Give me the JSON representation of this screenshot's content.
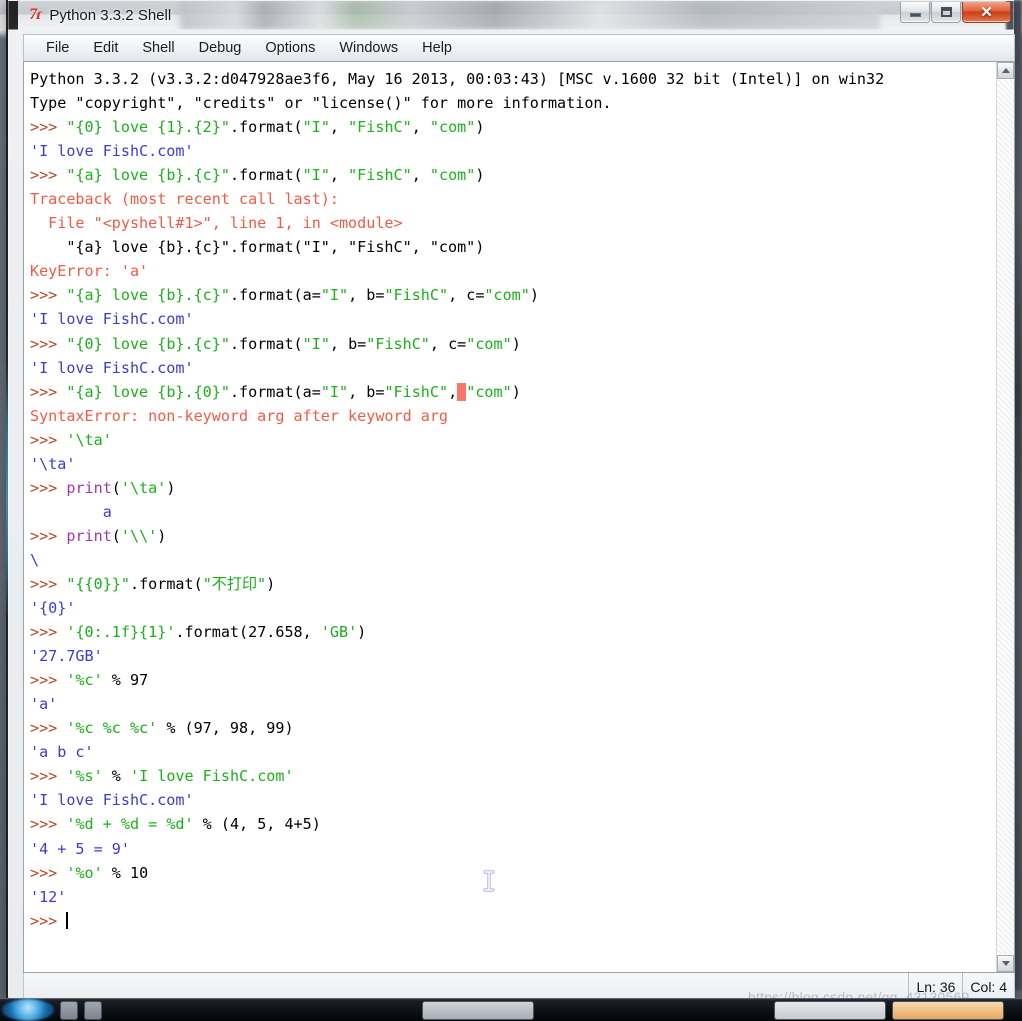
{
  "window": {
    "title": "Python 3.3.2 Shell",
    "icon": "python-logo-icon",
    "controls": {
      "minimize_label": "—",
      "maximize_label": "□",
      "close_label": "✕"
    }
  },
  "menu": {
    "items": [
      "File",
      "Edit",
      "Shell",
      "Debug",
      "Options",
      "Windows",
      "Help"
    ]
  },
  "colors": {
    "prompt": "#b5462b",
    "string": "#19b219",
    "output": "#3b3bd2",
    "error": "#f25a48",
    "builtin": "#a535a5",
    "plain": "#000000",
    "error_highlight": "#f7776a",
    "close_button": "#c73f17"
  },
  "shell": {
    "lines": [
      [
        {
          "t": "Python 3.3.2 (v3.3.2:d047928ae3f6, May 16 2013, 00:03:43) [MSC v.1600 32 bit (Intel)] on win32",
          "c": "plain"
        }
      ],
      [
        {
          "t": "Type \"copyright\", \"credits\" or \"license()\" for more information.",
          "c": "plain"
        }
      ],
      [
        {
          "t": ">>> ",
          "c": "prompt"
        },
        {
          "t": "\"{0} love {1}.{2}\"",
          "c": "str"
        },
        {
          "t": ".format(",
          "c": "plain"
        },
        {
          "t": "\"I\"",
          "c": "str"
        },
        {
          "t": ", ",
          "c": "plain"
        },
        {
          "t": "\"FishC\"",
          "c": "str"
        },
        {
          "t": ", ",
          "c": "plain"
        },
        {
          "t": "\"com\"",
          "c": "str"
        },
        {
          "t": ")",
          "c": "plain"
        }
      ],
      [
        {
          "t": "'I love FishC.com'",
          "c": "out"
        }
      ],
      [
        {
          "t": ">>> ",
          "c": "prompt"
        },
        {
          "t": "\"{a} love {b}.{c}\"",
          "c": "str"
        },
        {
          "t": ".format(",
          "c": "plain"
        },
        {
          "t": "\"I\"",
          "c": "str"
        },
        {
          "t": ", ",
          "c": "plain"
        },
        {
          "t": "\"FishC\"",
          "c": "str"
        },
        {
          "t": ", ",
          "c": "plain"
        },
        {
          "t": "\"com\"",
          "c": "str"
        },
        {
          "t": ")",
          "c": "plain"
        }
      ],
      [
        {
          "t": "Traceback (most recent call last):",
          "c": "err"
        }
      ],
      [
        {
          "t": "  File \"<pyshell#1>\", line 1, in <module>",
          "c": "err"
        }
      ],
      [
        {
          "t": "    \"{a} love {b}.{c}\".format(\"I\", \"FishC\", \"com\")",
          "c": "plain"
        }
      ],
      [
        {
          "t": "KeyError: 'a'",
          "c": "err"
        }
      ],
      [
        {
          "t": ">>> ",
          "c": "prompt"
        },
        {
          "t": "\"{a} love {b}.{c}\"",
          "c": "str"
        },
        {
          "t": ".format(a=",
          "c": "plain"
        },
        {
          "t": "\"I\"",
          "c": "str"
        },
        {
          "t": ", b=",
          "c": "plain"
        },
        {
          "t": "\"FishC\"",
          "c": "str"
        },
        {
          "t": ", c=",
          "c": "plain"
        },
        {
          "t": "\"com\"",
          "c": "str"
        },
        {
          "t": ")",
          "c": "plain"
        }
      ],
      [
        {
          "t": "'I love FishC.com'",
          "c": "out"
        }
      ],
      [
        {
          "t": ">>> ",
          "c": "prompt"
        },
        {
          "t": "\"{0} love {b}.{c}\"",
          "c": "str"
        },
        {
          "t": ".format(",
          "c": "plain"
        },
        {
          "t": "\"I\"",
          "c": "str"
        },
        {
          "t": ", b=",
          "c": "plain"
        },
        {
          "t": "\"FishC\"",
          "c": "str"
        },
        {
          "t": ", c=",
          "c": "plain"
        },
        {
          "t": "\"com\"",
          "c": "str"
        },
        {
          "t": ")",
          "c": "plain"
        }
      ],
      [
        {
          "t": "'I love FishC.com'",
          "c": "out"
        }
      ],
      [
        {
          "t": ">>> ",
          "c": "prompt"
        },
        {
          "t": "\"{a} love {b}.{0}\"",
          "c": "str"
        },
        {
          "t": ".format(a=",
          "c": "plain"
        },
        {
          "t": "\"I\"",
          "c": "str"
        },
        {
          "t": ", b=",
          "c": "plain"
        },
        {
          "t": "\"FishC\"",
          "c": "str"
        },
        {
          "t": ",",
          "c": "plain"
        },
        {
          "t": "X",
          "c": "errhl"
        },
        {
          "t": "\"com\"",
          "c": "str"
        },
        {
          "t": ")",
          "c": "plain"
        }
      ],
      [
        {
          "t": "SyntaxError: non-keyword arg after keyword arg",
          "c": "err"
        }
      ],
      [
        {
          "t": ">>> ",
          "c": "prompt"
        },
        {
          "t": "'\\ta'",
          "c": "str"
        }
      ],
      [
        {
          "t": "'\\ta'",
          "c": "out"
        }
      ],
      [
        {
          "t": ">>> ",
          "c": "prompt"
        },
        {
          "t": "print",
          "c": "builtin"
        },
        {
          "t": "(",
          "c": "plain"
        },
        {
          "t": "'\\ta'",
          "c": "str"
        },
        {
          "t": ")",
          "c": "plain"
        }
      ],
      [
        {
          "t": "        a",
          "c": "out"
        }
      ],
      [
        {
          "t": ">>> ",
          "c": "prompt"
        },
        {
          "t": "print",
          "c": "builtin"
        },
        {
          "t": "(",
          "c": "plain"
        },
        {
          "t": "'\\\\'",
          "c": "str"
        },
        {
          "t": ")",
          "c": "plain"
        }
      ],
      [
        {
          "t": "\\",
          "c": "out"
        }
      ],
      [
        {
          "t": ">>> ",
          "c": "prompt"
        },
        {
          "t": "\"{{0}}\"",
          "c": "str"
        },
        {
          "t": ".format(",
          "c": "plain"
        },
        {
          "t": "\"不打印\"",
          "c": "str"
        },
        {
          "t": ")",
          "c": "plain"
        }
      ],
      [
        {
          "t": "'{0}'",
          "c": "out"
        }
      ],
      [
        {
          "t": ">>> ",
          "c": "prompt"
        },
        {
          "t": "'{0:.1f}{1}'",
          "c": "str"
        },
        {
          "t": ".format(27.658, ",
          "c": "plain"
        },
        {
          "t": "'GB'",
          "c": "str"
        },
        {
          "t": ")",
          "c": "plain"
        }
      ],
      [
        {
          "t": "'27.7GB'",
          "c": "out"
        }
      ],
      [
        {
          "t": ">>> ",
          "c": "prompt"
        },
        {
          "t": "'%c'",
          "c": "str"
        },
        {
          "t": " % 97",
          "c": "plain"
        }
      ],
      [
        {
          "t": "'a'",
          "c": "out"
        }
      ],
      [
        {
          "t": ">>> ",
          "c": "prompt"
        },
        {
          "t": "'%c %c %c'",
          "c": "str"
        },
        {
          "t": " % (97, 98, 99)",
          "c": "plain"
        }
      ],
      [
        {
          "t": "'a b c'",
          "c": "out"
        }
      ],
      [
        {
          "t": ">>> ",
          "c": "prompt"
        },
        {
          "t": "'%s'",
          "c": "str"
        },
        {
          "t": " % ",
          "c": "plain"
        },
        {
          "t": "'I love FishC.com'",
          "c": "str"
        }
      ],
      [
        {
          "t": "'I love FishC.com'",
          "c": "out"
        }
      ],
      [
        {
          "t": ">>> ",
          "c": "prompt"
        },
        {
          "t": "'%d + %d = %d'",
          "c": "str"
        },
        {
          "t": " % (4, 5, 4+5)",
          "c": "plain"
        }
      ],
      [
        {
          "t": "'4 + 5 = 9'",
          "c": "out"
        }
      ],
      [
        {
          "t": ">>> ",
          "c": "prompt"
        },
        {
          "t": "'%o'",
          "c": "str"
        },
        {
          "t": " % 10",
          "c": "plain"
        }
      ],
      [
        {
          "t": "'12'",
          "c": "out"
        }
      ],
      [
        {
          "t": ">>> ",
          "c": "prompt"
        },
        {
          "t": "|CARET|",
          "c": "caret"
        }
      ]
    ]
  },
  "status": {
    "line_label": "Ln: 36",
    "col_label": "Col: 4"
  },
  "watermark": {
    "text": "https://blog.csdn.net/qq_43130569"
  },
  "scrollbar": {
    "up_arrow": "triangle-up-icon",
    "down_arrow": "triangle-down-icon"
  },
  "cursor": {
    "type": "i-beam-cursor"
  }
}
